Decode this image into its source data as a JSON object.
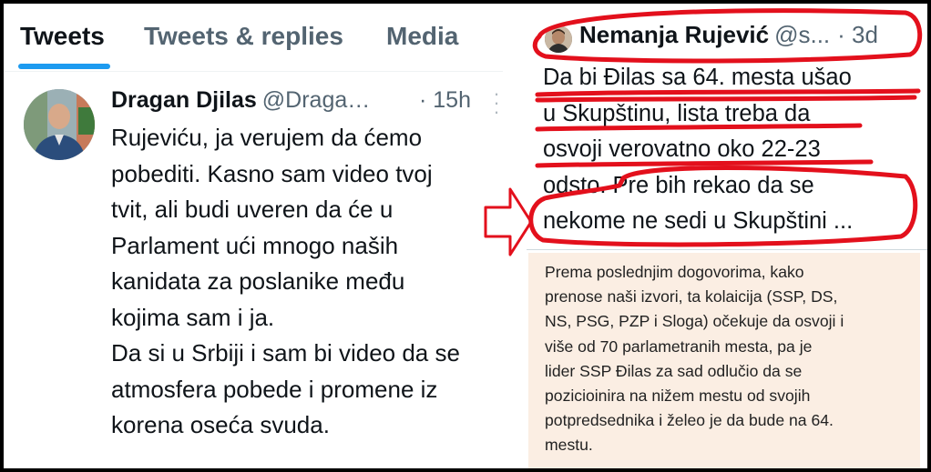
{
  "tabs": {
    "tweets": "Tweets",
    "tweets_replies": "Tweets & replies",
    "media": "Media"
  },
  "left_tweet": {
    "author_name": "Dragan Djilas",
    "author_handle": "@Draga…",
    "time": "· 15h",
    "more_icon": "vertical-ellipsis-icon",
    "paragraph1_lines": [
      "Rujeviću, ja verujem da ćemo",
      "pobediti. Kasno sam video tvoj",
      "tvit, ali budi uveren da će u",
      "Parlament ući mnogo naših",
      "kanidata za poslanike među",
      "kojima sam i ja."
    ],
    "paragraph2_lines": [
      "Da si u Srbiji i sam bi video da se",
      "atmosfera pobede i promene iz",
      "korena oseća svuda."
    ]
  },
  "right_tweet": {
    "author_name": "Nemanja Rujević",
    "author_handle": "@s...",
    "time": "· 3d",
    "text_lines": [
      "Da bi Đilas sa 64. mesta ušao",
      "u Skupštinu, lista treba da",
      "osvoji verovatno oko 22-23",
      "odsto. Pre bih rekao da se",
      "nekome ne sedi u Skupštini ..."
    ]
  },
  "article": {
    "lines": [
      "Prema poslednjim dogovorima, kako",
      "prenose naši izvori, ta kolaicija (SSP, DS,",
      "NS, PSG, PZP i Sloga) očekuje da osvoji i",
      "više od 70 parlametranih mesta, pa je",
      "lider SSP Đilas za sad odlučio da se",
      "pozicioinira na nižem mestu od svojih",
      "potpredsednika i želeo je da bude na 64.",
      "mestu."
    ]
  },
  "colors": {
    "accent": "#1d9bf0",
    "primary_text": "#0f1419",
    "secondary_text": "#536471",
    "annotation_red": "#e3101c",
    "article_bg": "#fbeee3"
  }
}
